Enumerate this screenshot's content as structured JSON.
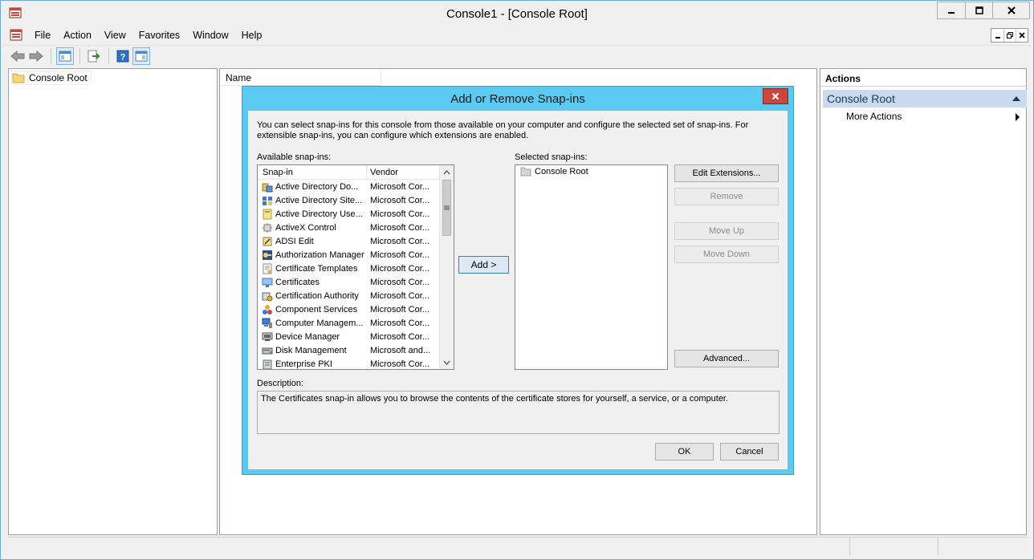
{
  "window": {
    "title": "Console1 - [Console Root]"
  },
  "menu": {
    "items": [
      "File",
      "Action",
      "View",
      "Favorites",
      "Window",
      "Help"
    ]
  },
  "tree": {
    "root_label": "Console Root"
  },
  "center": {
    "column_name": "Name"
  },
  "actions": {
    "title": "Actions",
    "group_label": "Console Root",
    "more_actions": "More Actions"
  },
  "dialog": {
    "title": "Add or Remove Snap-ins",
    "close_label": "x",
    "intro": "You can select snap-ins for this console from those available on your computer and configure the selected set of snap-ins. For extensible snap-ins, you can configure which extensions are enabled.",
    "available_label": "Available snap-ins:",
    "selected_label": "Selected snap-ins:",
    "col_snapin": "Snap-in",
    "col_vendor": "Vendor",
    "snapins": [
      {
        "name": "Active Directory Do...",
        "vendor": "Microsoft Cor...",
        "icon": "ad-domains-icon"
      },
      {
        "name": "Active Directory Site...",
        "vendor": "Microsoft Cor...",
        "icon": "ad-sites-icon"
      },
      {
        "name": "Active Directory Use...",
        "vendor": "Microsoft Cor...",
        "icon": "ad-users-icon"
      },
      {
        "name": "ActiveX Control",
        "vendor": "Microsoft Cor...",
        "icon": "activex-icon"
      },
      {
        "name": "ADSI Edit",
        "vendor": "Microsoft Cor...",
        "icon": "adsi-edit-icon"
      },
      {
        "name": "Authorization Manager",
        "vendor": "Microsoft Cor...",
        "icon": "authorization-icon"
      },
      {
        "name": "Certificate Templates",
        "vendor": "Microsoft Cor...",
        "icon": "cert-templates-icon"
      },
      {
        "name": "Certificates",
        "vendor": "Microsoft Cor...",
        "icon": "certificates-icon"
      },
      {
        "name": "Certification Authority",
        "vendor": "Microsoft Cor...",
        "icon": "cert-authority-icon"
      },
      {
        "name": "Component Services",
        "vendor": "Microsoft Cor...",
        "icon": "component-services-icon"
      },
      {
        "name": "Computer Managem...",
        "vendor": "Microsoft Cor...",
        "icon": "computer-management-icon"
      },
      {
        "name": "Device Manager",
        "vendor": "Microsoft Cor...",
        "icon": "device-manager-icon"
      },
      {
        "name": "Disk Management",
        "vendor": "Microsoft and...",
        "icon": "disk-management-icon"
      },
      {
        "name": "Enterprise PKI",
        "vendor": "Microsoft Cor...",
        "icon": "enterprise-pki-icon"
      }
    ],
    "add_label": "Add >",
    "selected_root": "Console Root",
    "edit_extensions": "Edit Extensions...",
    "remove": "Remove",
    "move_up": "Move Up",
    "move_down": "Move Down",
    "advanced": "Advanced...",
    "description_label": "Description:",
    "description_text": "The Certificates snap-in allows you to browse the contents of the certificate stores for yourself, a service, or a computer.",
    "ok": "OK",
    "cancel": "Cancel"
  }
}
